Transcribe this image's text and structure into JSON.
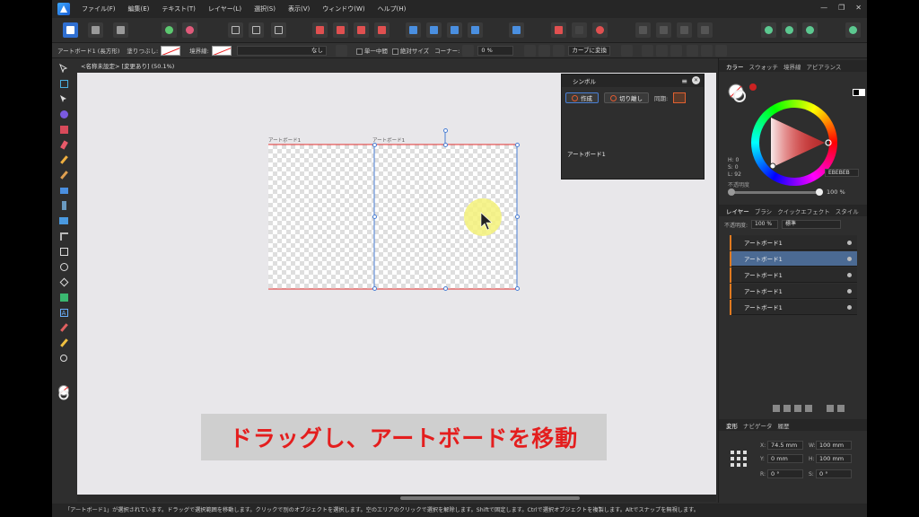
{
  "menubar": {
    "items": [
      "ファイル(F)",
      "編集(E)",
      "テキスト(T)",
      "レイヤー(L)",
      "選択(S)",
      "表示(V)",
      "ウィンドウ(W)",
      "ヘルプ(H)"
    ],
    "window_controls": [
      "—",
      "❐",
      "✕"
    ]
  },
  "context_toolbar": {
    "selection": "アートボード1 (長方形)",
    "fill_label": "塗りつぶし:",
    "stroke_label": "境界線:",
    "stroke_style": "なし",
    "option_single_mid": "単一中間",
    "option_absolute_size": "絶対サイズ",
    "corner_label": "コーナー:",
    "corner_value": "0 %",
    "convert_curves": "カーブに変換"
  },
  "document": {
    "tab_title": "<名称未設定> [変更あり] (50.1%)"
  },
  "canvas": {
    "artboard_left_label": "アートボード1",
    "artboard_right_label": "アートボード1",
    "caption": "ドラッグし、アートボードを移動"
  },
  "symbol_panel": {
    "title": "シンボル",
    "create_button": "作成",
    "detach_button": "切り離し",
    "sync_label": "同期:",
    "symbol_name": "アートボード1"
  },
  "color_panel": {
    "tabs": [
      "カラー",
      "スウォッチ",
      "境界線",
      "アピアランス"
    ],
    "h": "H: 0",
    "s": "S: 0",
    "l": "L: 92",
    "hex": "EBEBEB",
    "opacity_label": "不透明度",
    "opacity_value": "100 %"
  },
  "layers_panel": {
    "tabs": [
      "レイヤー",
      "ブラシ",
      "クイックエフェクト",
      "スタイル"
    ],
    "opacity_label": "不透明度:",
    "opacity_value": "100 %",
    "blend_mode": "標準",
    "rows": [
      {
        "name": "アートボード1",
        "selected": false
      },
      {
        "name": "アートボード1",
        "selected": true
      },
      {
        "name": "アートボード1",
        "selected": false
      },
      {
        "name": "アートボード1",
        "selected": false
      },
      {
        "name": "アートボード1",
        "selected": false
      }
    ]
  },
  "transform_panel": {
    "tabs": [
      "変形",
      "ナビゲータ",
      "履歴"
    ],
    "x": "74.5 mm",
    "y": "0 mm",
    "w": "100 mm",
    "h": "100 mm",
    "r": "0 °",
    "s": "0 °",
    "x_label": "X:",
    "y_label": "Y:",
    "w_label": "W:",
    "h_label": "H:",
    "r_label": "R:",
    "s_label": "S:"
  },
  "statusbar": {
    "text": "「アートボード1」が選択されています。ドラッグで選択範囲を移動します。クリックで別のオブジェクトを選択します。空のエリアのクリックで選択を解除します。Shiftで固定します。Ctrlで選択オブジェクトを複製します。Altでスナップを無視します。"
  },
  "colors": {
    "accent": "#2f6fd1",
    "caption_text": "#e41e1e",
    "caption_bg": "#cfcfcf",
    "artboard_outline": "#e03030",
    "selection_blue": "#4a7fd4",
    "cursor_highlight": "#f4f27a"
  }
}
